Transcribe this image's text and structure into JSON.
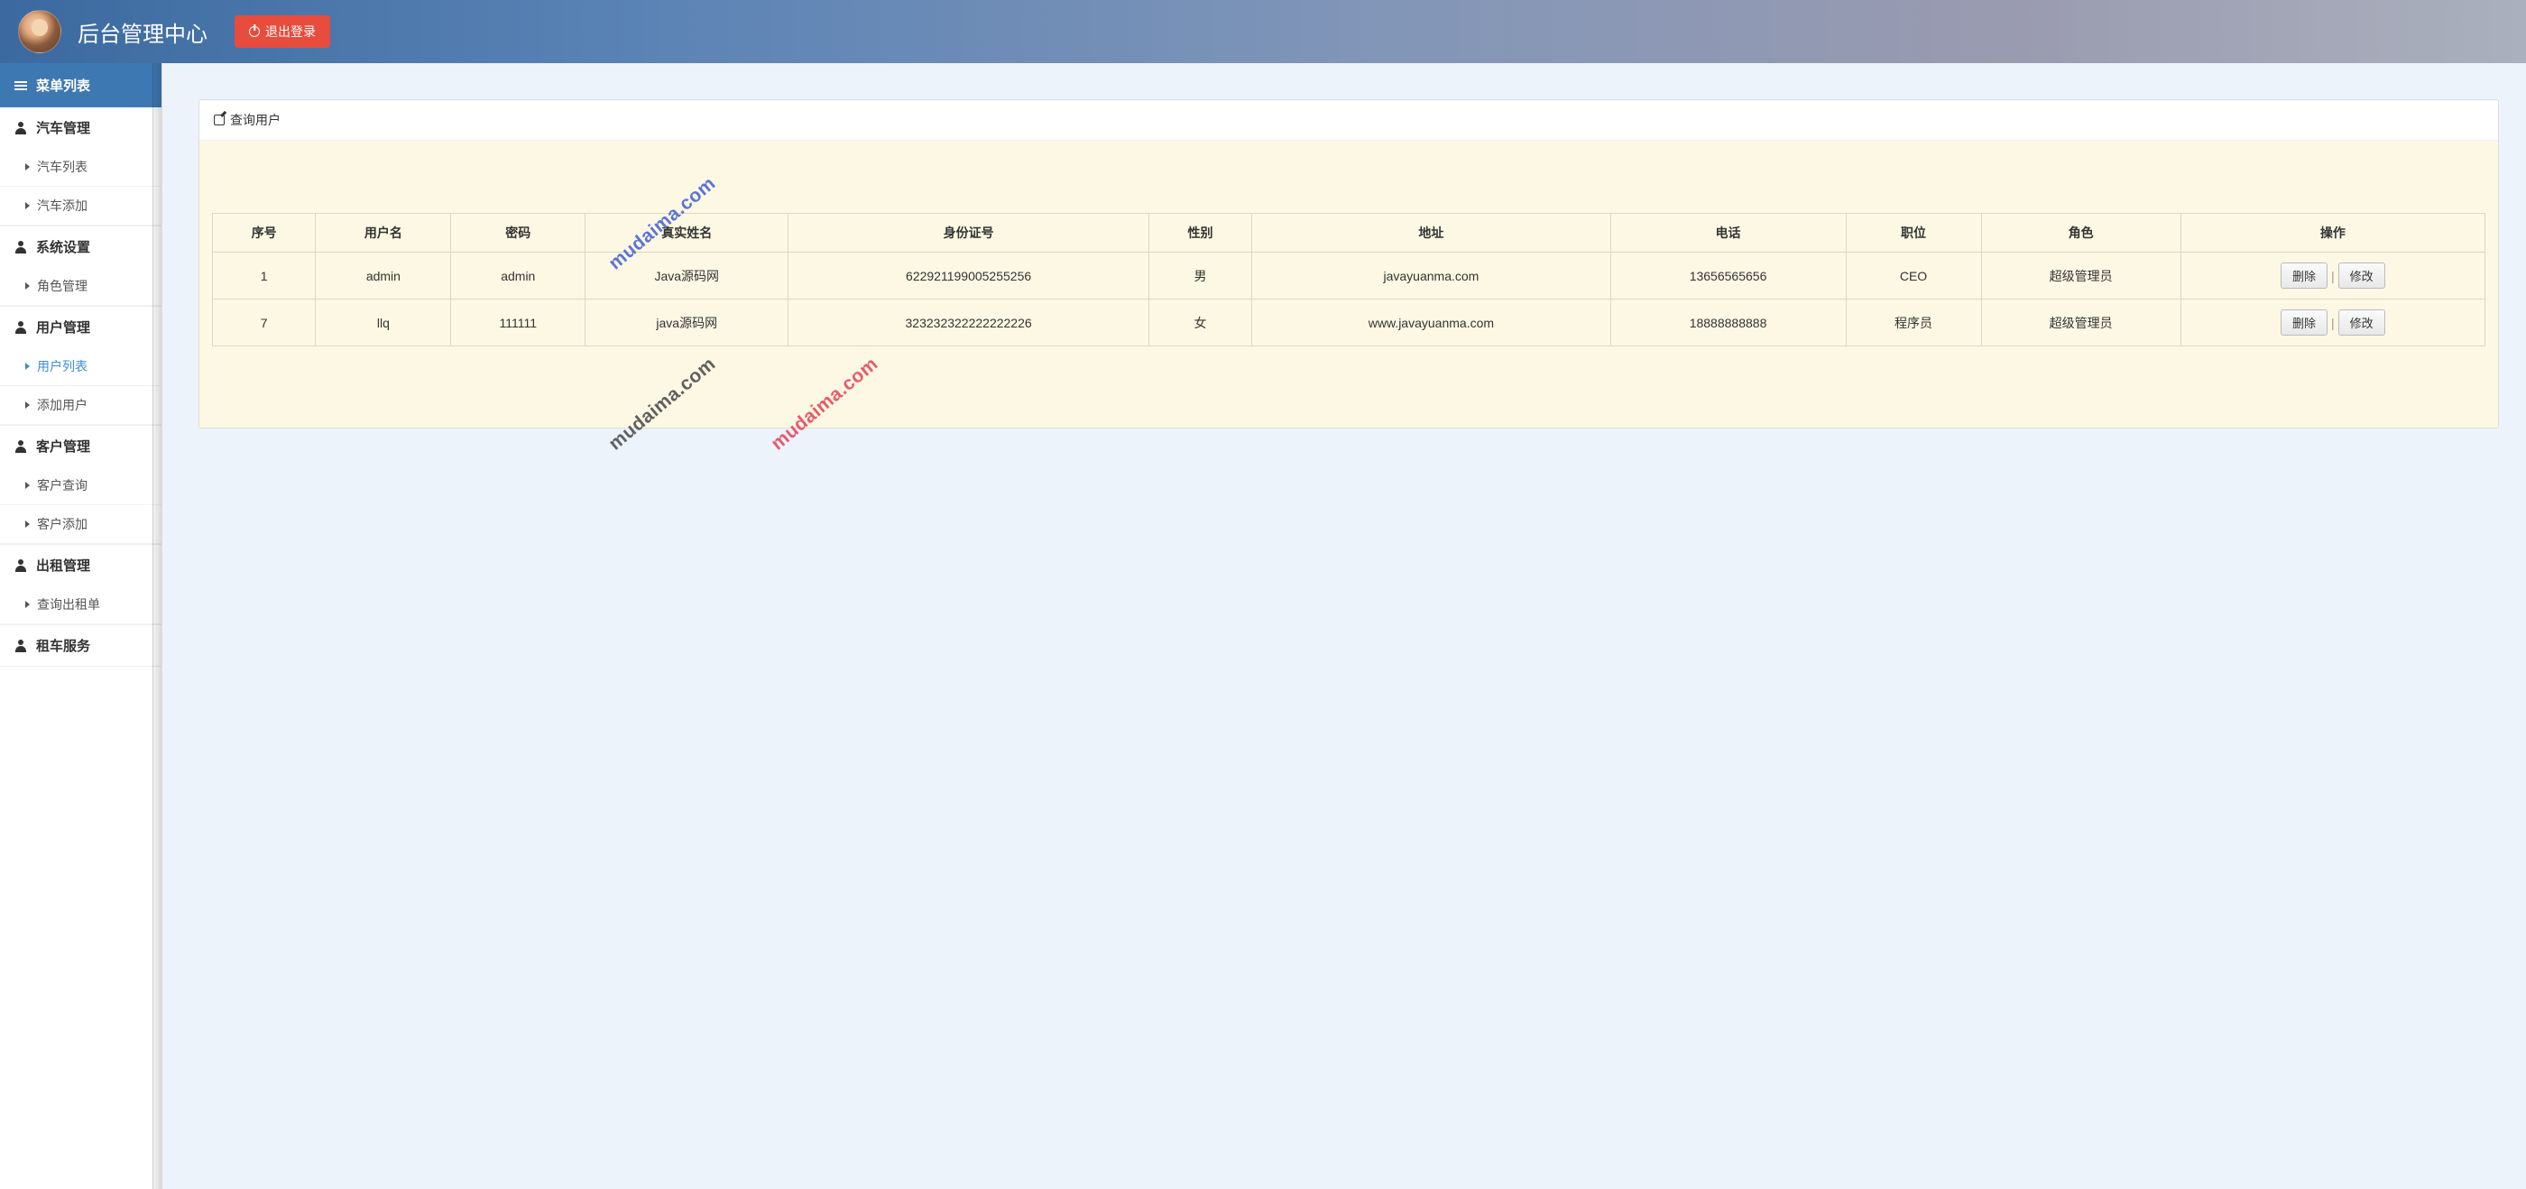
{
  "header": {
    "title": "后台管理中心",
    "logout_label": "退出登录"
  },
  "sidebar": {
    "menu_header": "菜单列表",
    "groups": [
      {
        "title": "汽车管理",
        "items": [
          {
            "label": "汽车列表",
            "active": false
          },
          {
            "label": "汽车添加",
            "active": false
          }
        ]
      },
      {
        "title": "系统设置",
        "items": [
          {
            "label": "角色管理",
            "active": false
          }
        ]
      },
      {
        "title": "用户管理",
        "items": [
          {
            "label": "用户列表",
            "active": true
          },
          {
            "label": "添加用户",
            "active": false
          }
        ]
      },
      {
        "title": "客户管理",
        "items": [
          {
            "label": "客户查询",
            "active": false
          },
          {
            "label": "客户添加",
            "active": false
          }
        ]
      },
      {
        "title": "出租管理",
        "items": [
          {
            "label": "查询出租单",
            "active": false
          }
        ]
      },
      {
        "title": "租车服务",
        "items": []
      }
    ]
  },
  "panel": {
    "title": "查询用户",
    "columns": [
      "序号",
      "用户名",
      "密码",
      "真实姓名",
      "身份证号",
      "性别",
      "地址",
      "电话",
      "职位",
      "角色",
      "操作"
    ],
    "rows": [
      {
        "id": "1",
        "username": "admin",
        "password": "admin",
        "realname": "Java源码网",
        "idcard": "622921199005255256",
        "gender": "男",
        "address": "javayuanma.com",
        "phone": "13656565656",
        "position": "CEO",
        "role": "超级管理员"
      },
      {
        "id": "7",
        "username": "llq",
        "password": "111111",
        "realname": "java源码网",
        "idcard": "323232322222222226",
        "gender": "女",
        "address": "www.javayuanma.com",
        "phone": "18888888888",
        "position": "程序员",
        "role": "超级管理员"
      }
    ],
    "actions": {
      "delete_label": "删除",
      "edit_label": "修改",
      "separator": "|"
    }
  },
  "watermark": "mudaima.com"
}
